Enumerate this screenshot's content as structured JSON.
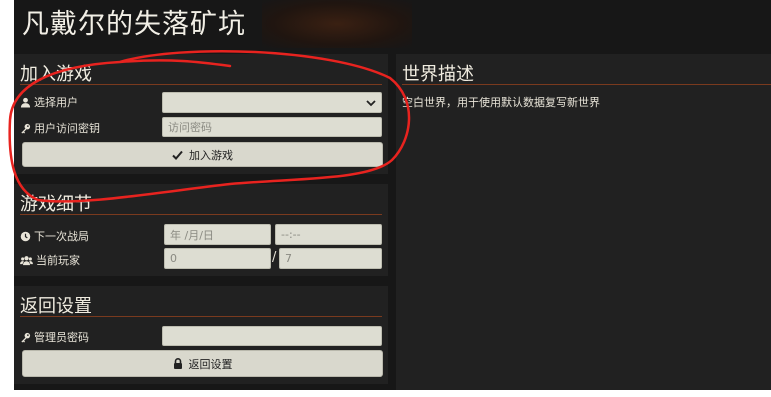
{
  "app": {
    "title": "凡戴尔的失落矿坑"
  },
  "join": {
    "heading": "加入游戏",
    "select_user_label": "选择用户",
    "select_user_value": "",
    "access_key_label": "用户访问密钥",
    "access_key_placeholder": "访问密码",
    "join_button": "加入游戏"
  },
  "world": {
    "heading": "世界描述",
    "description": "空白世界，用于使用默认数据复写新世界"
  },
  "details": {
    "heading": "游戏细节",
    "next_battle_label": "下一次战局",
    "date_placeholder": "年 /月/日",
    "time_placeholder": "--:--",
    "players_label": "当前玩家",
    "players_current": "0",
    "players_separator": "/",
    "players_max": "7"
  },
  "back": {
    "heading": "返回设置",
    "admin_password_label": "管理员密码",
    "admin_password_value": "",
    "back_button": "返回设置"
  },
  "colors": {
    "accent_rule": "#7a3a1e",
    "annotation": "#e8231f"
  },
  "icons": [
    "user-icon",
    "key-icon",
    "check-icon",
    "clock-icon",
    "users-icon",
    "lock-icon",
    "chevron-down-icon"
  ]
}
